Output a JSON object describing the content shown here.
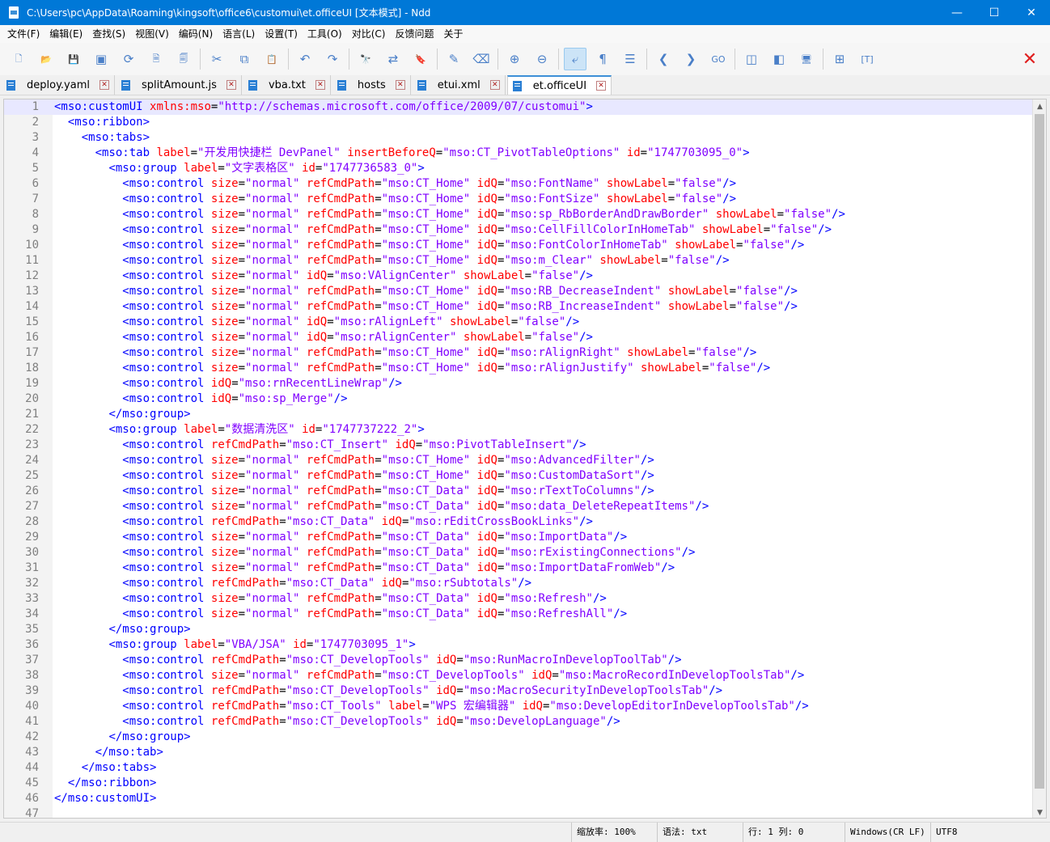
{
  "window": {
    "title": "C:\\Users\\pc\\AppData\\Roaming\\kingsoft\\office6\\customui\\et.officeUI [文本模式] - Ndd",
    "minimize": "—",
    "maximize": "☐",
    "close": "✕"
  },
  "menu": [
    "文件(F)",
    "编辑(E)",
    "查找(S)",
    "视图(V)",
    "编码(N)",
    "语言(L)",
    "设置(T)",
    "工具(O)",
    "对比(C)",
    "反馈问题",
    "关于"
  ],
  "toolbar": {
    "icons": [
      {
        "name": "new-file-icon",
        "glyph": "🗋"
      },
      {
        "name": "open-folder-icon",
        "glyph": "📂"
      },
      {
        "name": "save-icon",
        "glyph": "💾"
      },
      {
        "name": "save-all-icon",
        "glyph": "▣"
      },
      {
        "name": "reload-icon",
        "glyph": "⟳"
      },
      {
        "name": "close-file-icon",
        "glyph": "🗎"
      },
      {
        "name": "close-all-icon",
        "glyph": "🗐"
      },
      {
        "sep": true
      },
      {
        "name": "cut-icon",
        "glyph": "✂"
      },
      {
        "name": "copy-icon",
        "glyph": "⧉"
      },
      {
        "name": "paste-icon",
        "glyph": "📋"
      },
      {
        "sep": true
      },
      {
        "name": "undo-icon",
        "glyph": "↶"
      },
      {
        "name": "redo-icon",
        "glyph": "↷"
      },
      {
        "sep": true
      },
      {
        "name": "find-icon",
        "glyph": "🔭"
      },
      {
        "name": "replace-icon",
        "glyph": "⇄"
      },
      {
        "name": "bookmark-icon",
        "glyph": "🔖"
      },
      {
        "sep": true
      },
      {
        "name": "marker-icon",
        "glyph": "✎"
      },
      {
        "name": "clear-mark-icon",
        "glyph": "⌫"
      },
      {
        "sep": true
      },
      {
        "name": "zoom-in-icon",
        "glyph": "⊕"
      },
      {
        "name": "zoom-out-icon",
        "glyph": "⊖"
      },
      {
        "sep": true
      },
      {
        "name": "word-wrap-icon",
        "glyph": "⤶",
        "active": true
      },
      {
        "name": "show-symbols-icon",
        "glyph": "¶"
      },
      {
        "name": "indent-guide-icon",
        "glyph": "☰"
      },
      {
        "sep": true
      },
      {
        "name": "prev-icon",
        "glyph": "❮"
      },
      {
        "name": "next-icon",
        "glyph": "❯"
      },
      {
        "name": "goto-icon",
        "glyph": "GO"
      },
      {
        "sep": true
      },
      {
        "name": "compare-icon",
        "glyph": "◫"
      },
      {
        "name": "split-view-icon",
        "glyph": "◧"
      },
      {
        "name": "monitor-icon",
        "glyph": "🖥"
      },
      {
        "sep": true
      },
      {
        "name": "tree-icon",
        "glyph": "⊞"
      },
      {
        "name": "text-mode-icon",
        "glyph": "[T]"
      }
    ],
    "close_glyph": "✕"
  },
  "tabs": [
    {
      "label": "deploy.yaml",
      "active": false
    },
    {
      "label": "splitAmount.js",
      "active": false
    },
    {
      "label": "vba.txt",
      "active": false
    },
    {
      "label": "hosts",
      "active": false
    },
    {
      "label": "etui.xml",
      "active": false
    },
    {
      "label": "et.officeUI",
      "active": true
    }
  ],
  "tab_close_glyph": "✕",
  "editor": {
    "current_line": 1,
    "lines": [
      "<mso:customUI xmlns:mso=\"http://schemas.microsoft.com/office/2009/07/customui\">",
      "  <mso:ribbon>",
      "    <mso:tabs>",
      "      <mso:tab label=\"开发用快捷栏 DevPanel\" insertBeforeQ=\"mso:CT_PivotTableOptions\" id=\"1747703095_0\">",
      "        <mso:group label=\"文字表格区\" id=\"1747736583_0\">",
      "          <mso:control size=\"normal\" refCmdPath=\"mso:CT_Home\" idQ=\"mso:FontName\" showLabel=\"false\"/>",
      "          <mso:control size=\"normal\" refCmdPath=\"mso:CT_Home\" idQ=\"mso:FontSize\" showLabel=\"false\"/>",
      "          <mso:control size=\"normal\" refCmdPath=\"mso:CT_Home\" idQ=\"mso:sp_RbBorderAndDrawBorder\" showLabel=\"false\"/>",
      "          <mso:control size=\"normal\" refCmdPath=\"mso:CT_Home\" idQ=\"mso:CellFillColorInHomeTab\" showLabel=\"false\"/>",
      "          <mso:control size=\"normal\" refCmdPath=\"mso:CT_Home\" idQ=\"mso:FontColorInHomeTab\" showLabel=\"false\"/>",
      "          <mso:control size=\"normal\" refCmdPath=\"mso:CT_Home\" idQ=\"mso:m_Clear\" showLabel=\"false\"/>",
      "          <mso:control size=\"normal\" idQ=\"mso:VAlignCenter\" showLabel=\"false\"/>",
      "          <mso:control size=\"normal\" refCmdPath=\"mso:CT_Home\" idQ=\"mso:RB_DecreaseIndent\" showLabel=\"false\"/>",
      "          <mso:control size=\"normal\" refCmdPath=\"mso:CT_Home\" idQ=\"mso:RB_IncreaseIndent\" showLabel=\"false\"/>",
      "          <mso:control size=\"normal\" idQ=\"mso:rAlignLeft\" showLabel=\"false\"/>",
      "          <mso:control size=\"normal\" idQ=\"mso:rAlignCenter\" showLabel=\"false\"/>",
      "          <mso:control size=\"normal\" refCmdPath=\"mso:CT_Home\" idQ=\"mso:rAlignRight\" showLabel=\"false\"/>",
      "          <mso:control size=\"normal\" refCmdPath=\"mso:CT_Home\" idQ=\"mso:rAlignJustify\" showLabel=\"false\"/>",
      "          <mso:control idQ=\"mso:rnRecentLineWrap\"/>",
      "          <mso:control idQ=\"mso:sp_Merge\"/>",
      "        </mso:group>",
      "        <mso:group label=\"数据清洗区\" id=\"1747737222_2\">",
      "          <mso:control refCmdPath=\"mso:CT_Insert\" idQ=\"mso:PivotTableInsert\"/>",
      "          <mso:control size=\"normal\" refCmdPath=\"mso:CT_Home\" idQ=\"mso:AdvancedFilter\"/>",
      "          <mso:control size=\"normal\" refCmdPath=\"mso:CT_Home\" idQ=\"mso:CustomDataSort\"/>",
      "          <mso:control size=\"normal\" refCmdPath=\"mso:CT_Data\" idQ=\"mso:rTextToColumns\"/>",
      "          <mso:control size=\"normal\" refCmdPath=\"mso:CT_Data\" idQ=\"mso:data_DeleteRepeatItems\"/>",
      "          <mso:control refCmdPath=\"mso:CT_Data\" idQ=\"mso:rEditCrossBookLinks\"/>",
      "          <mso:control size=\"normal\" refCmdPath=\"mso:CT_Data\" idQ=\"mso:ImportData\"/>",
      "          <mso:control size=\"normal\" refCmdPath=\"mso:CT_Data\" idQ=\"mso:rExistingConnections\"/>",
      "          <mso:control size=\"normal\" refCmdPath=\"mso:CT_Data\" idQ=\"mso:ImportDataFromWeb\"/>",
      "          <mso:control refCmdPath=\"mso:CT_Data\" idQ=\"mso:rSubtotals\"/>",
      "          <mso:control size=\"normal\" refCmdPath=\"mso:CT_Data\" idQ=\"mso:Refresh\"/>",
      "          <mso:control size=\"normal\" refCmdPath=\"mso:CT_Data\" idQ=\"mso:RefreshAll\"/>",
      "        </mso:group>",
      "        <mso:group label=\"VBA/JSA\" id=\"1747703095_1\">",
      "          <mso:control refCmdPath=\"mso:CT_DevelopTools\" idQ=\"mso:RunMacroInDevelopToolTab\"/>",
      "          <mso:control size=\"normal\" refCmdPath=\"mso:CT_DevelopTools\" idQ=\"mso:MacroRecordInDevelopToolsTab\"/>",
      "          <mso:control refCmdPath=\"mso:CT_DevelopTools\" idQ=\"mso:MacroSecurityInDevelopToolsTab\"/>",
      "          <mso:control refCmdPath=\"mso:CT_Tools\" label=\"WPS 宏编辑器\" idQ=\"mso:DevelopEditorInDevelopToolsTab\"/>",
      "          <mso:control refCmdPath=\"mso:CT_DevelopTools\" idQ=\"mso:DevelopLanguage\"/>",
      "        </mso:group>",
      "      </mso:tab>",
      "    </mso:tabs>",
      "  </mso:ribbon>",
      "</mso:customUI>",
      ""
    ]
  },
  "scrollbar": {
    "up": "▲",
    "down": "▼"
  },
  "status": {
    "zoom": "缩放率: 100%",
    "language": "语法: txt",
    "position": "行: 1 列: 0",
    "eol": "Windows(CR LF)",
    "encoding": "UTF8"
  }
}
